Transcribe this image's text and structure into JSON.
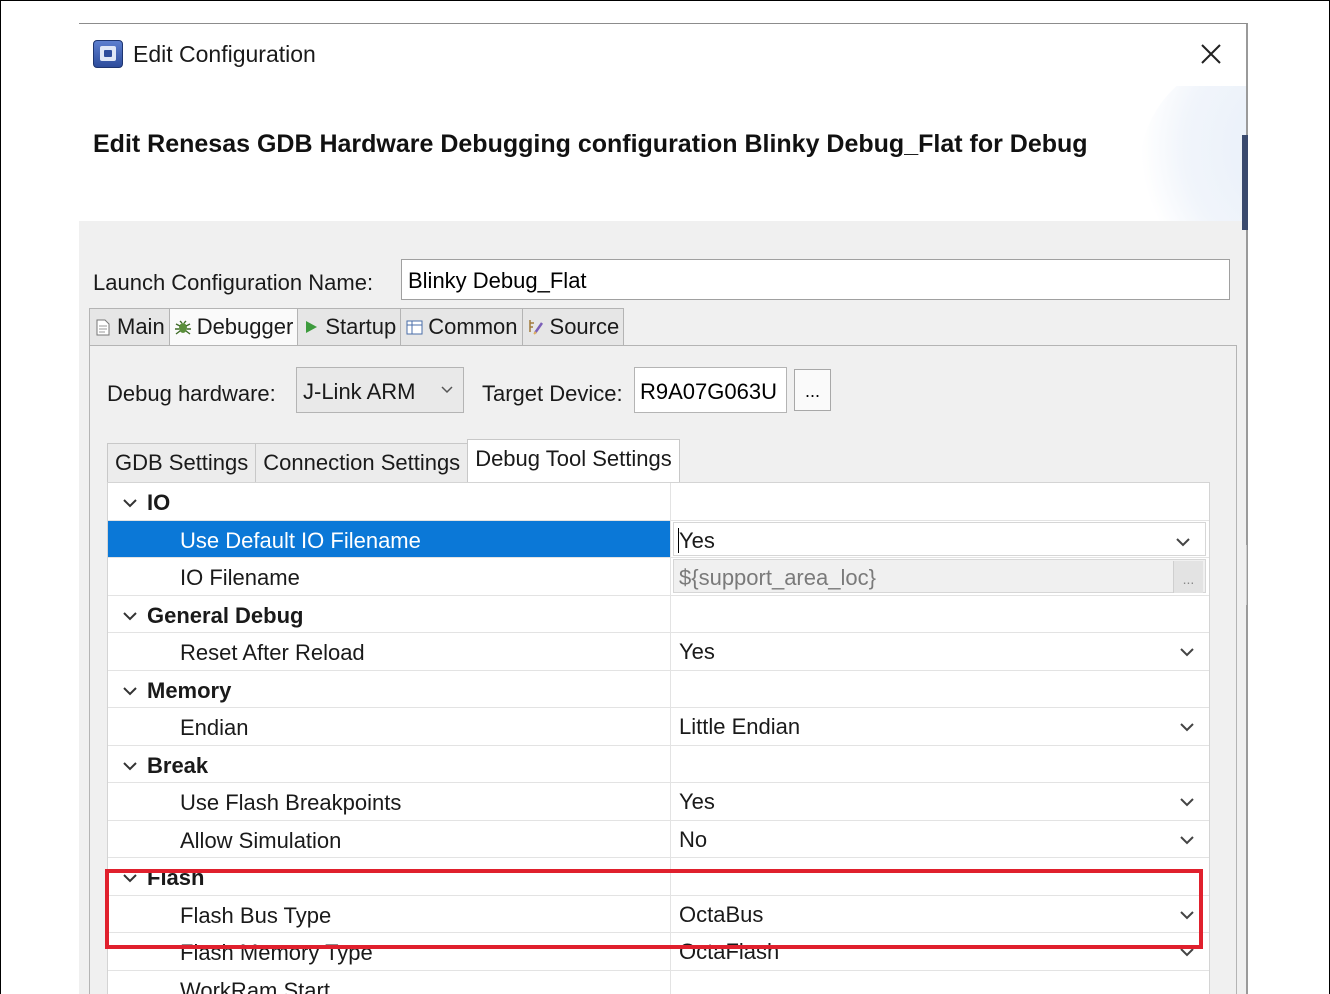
{
  "window": {
    "title": "Edit Configuration",
    "close_icon": "close-icon"
  },
  "header": {
    "title": "Edit Renesas GDB Hardware Debugging configuration Blinky Debug_Flat for Debug"
  },
  "launch_config": {
    "label": "Launch Configuration Name:",
    "value": "Blinky Debug_Flat"
  },
  "main_tabs": [
    {
      "label": "Main",
      "icon": "document-icon",
      "active": false
    },
    {
      "label": "Debugger",
      "icon": "bug-icon",
      "active": true
    },
    {
      "label": "Startup",
      "icon": "play-icon",
      "active": false
    },
    {
      "label": "Common",
      "icon": "table-icon",
      "active": false
    },
    {
      "label": "Source",
      "icon": "source-icon",
      "active": false
    }
  ],
  "debugger": {
    "debug_hardware_label": "Debug hardware:",
    "debug_hardware_value": "J-Link ARM",
    "target_device_label": "Target Device:",
    "target_device_value": "R9A07G063U",
    "browse_label": "..."
  },
  "sub_tabs": [
    {
      "label": "GDB Settings",
      "active": false
    },
    {
      "label": "Connection Settings",
      "active": false
    },
    {
      "label": "Debug Tool Settings",
      "active": true
    }
  ],
  "properties": {
    "categories": {
      "io": "IO",
      "general_debug": "General Debug",
      "memory": "Memory",
      "break": "Break",
      "flash": "Flash"
    },
    "rows": {
      "use_default_io_filename": {
        "name": "Use Default IO Filename",
        "value": "Yes"
      },
      "io_filename": {
        "name": "IO Filename",
        "value": "${support_area_loc}",
        "button": "..."
      },
      "reset_after_reload": {
        "name": "Reset After Reload",
        "value": "Yes"
      },
      "endian": {
        "name": "Endian",
        "value": "Little Endian"
      },
      "use_flash_breakpoints": {
        "name": "Use Flash Breakpoints",
        "value": "Yes"
      },
      "allow_simulation": {
        "name": "Allow Simulation",
        "value": "No"
      },
      "flash_bus_type": {
        "name": "Flash Bus Type",
        "value": "OctaBus"
      },
      "flash_memory_type": {
        "name": "Flash Memory Type",
        "value": "OctaFlash"
      },
      "workram_start": {
        "name": "WorkRam Start",
        "value": ""
      }
    }
  },
  "colors": {
    "selection": "#0b78d7",
    "highlight_annotation": "#e0202d",
    "panel_background": "#f0f0f0"
  }
}
